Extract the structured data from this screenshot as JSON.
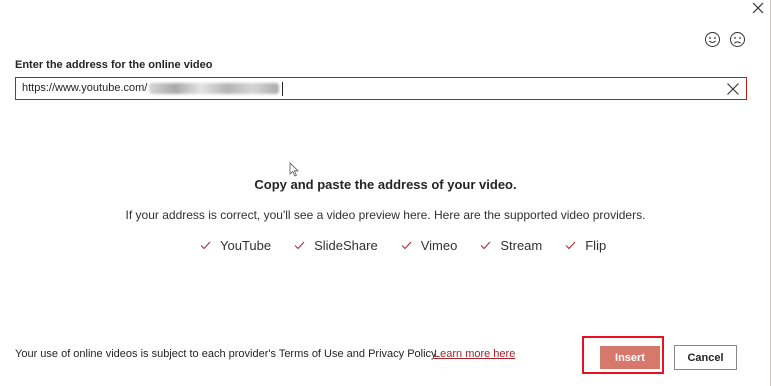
{
  "dialog": {
    "label": "Enter the address for the online video",
    "url_value": "https://www.youtube.com/",
    "heading": "Copy and paste the address of your video.",
    "subtext": "If your address is correct, you'll see a video preview here. Here are the supported video providers.",
    "providers": [
      "YouTube",
      "SlideShare",
      "Vimeo",
      "Stream",
      "Flip"
    ]
  },
  "footer": {
    "terms_text": "Your use of online videos is subject to each provider's Terms of Use and Privacy Policy.",
    "learn_more": "Learn more here"
  },
  "buttons": {
    "insert": "Insert",
    "cancel": "Cancel"
  },
  "icons": {
    "close": "close-icon",
    "smile": "smile-icon",
    "frown": "frown-icon",
    "clear": "clear-icon",
    "check": "check-icon",
    "cursor": "mouse-cursor-icon"
  },
  "colors": {
    "accent": "#a4262c",
    "insert_bg": "#d6786c",
    "highlight": "#e81123"
  }
}
